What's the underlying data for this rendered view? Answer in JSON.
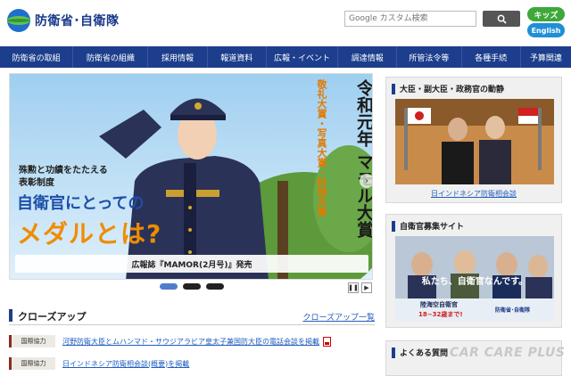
{
  "header": {
    "logo_text": "防衛省･自衛隊",
    "search_placeholder": "Google カスタム検索",
    "kids_label": "キッズ",
    "english_label": "English"
  },
  "nav": {
    "items": [
      "防衛省の取組",
      "防衛省の組織",
      "採用情報",
      "報道資料",
      "広報・イベント",
      "調達情報",
      "所管法令等",
      "各種手続",
      "予算関連"
    ]
  },
  "hero": {
    "title_vertical": "令和元年 マモル大賞",
    "subtitle_vertical": "敬礼大賞・写真大賞・料理大賞",
    "text_line1": "殊勲と功績をたたえる",
    "text_line2": "表彰制度",
    "headline1": "自衛官にとっての",
    "headline2": "メダルとは?",
    "caption": "広報誌『MAMOR(2月号)』発売"
  },
  "closeup": {
    "title": "クローズアップ",
    "list_link": "クローズアップ一覧",
    "items": [
      {
        "tag": "国際協力",
        "text": "河野防衛大臣とムハンマド・サウジアラビア皇太子兼国防大臣の電話会談を掲載",
        "pdf": true
      },
      {
        "tag": "国際協力",
        "text": "日インドネシア防衛相会談(概要)を掲載",
        "pdf": false
      }
    ]
  },
  "sidebar": {
    "panel1": {
      "title": "大臣・副大臣・政務官の動静",
      "link": "日インドネシア防衛相会談"
    },
    "panel2": {
      "title": "自衛官募集サイト",
      "banner_text": "私たち、自衛官なんです。",
      "banner_sub": "陸海空自衛官",
      "banner_age": "18~32歳まで!",
      "banner_logo": "防衛省･自衛隊"
    },
    "panel3": {
      "title": "よくある質問"
    }
  },
  "watermark": "CAR CARE PLUS",
  "colors": {
    "nav_bg": "#1c3e8c",
    "kids": "#3ea83a",
    "english": "#1f8fd6",
    "headline_blue": "#1c4fa8",
    "headline_orange": "#f08c00"
  }
}
